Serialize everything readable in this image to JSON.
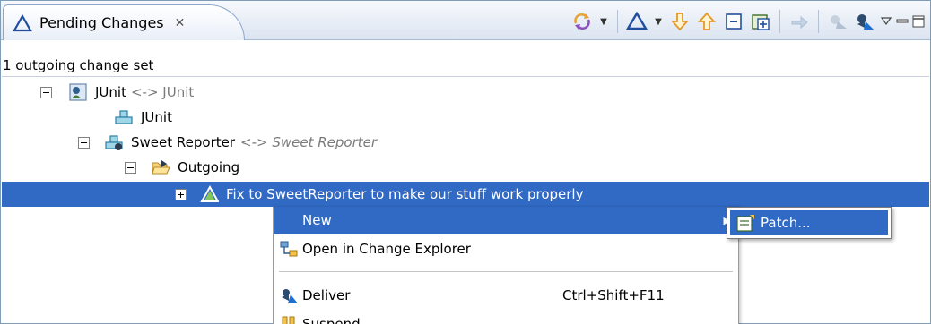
{
  "view": {
    "tab_label": "Pending Changes",
    "tab_close_glyph": "✕",
    "toolbar_icons": [
      "sync-icon",
      "warning-filter-icon",
      "expand-down-icon",
      "collapse-up-icon",
      "collapse-all-icon",
      "new-icon",
      "accept-icon",
      "deliver-icon",
      "deliver-all-icon",
      "view-menu-icon",
      "minimize-icon",
      "maximize-icon"
    ]
  },
  "status_line": "1 outgoing change set",
  "tree": {
    "root": {
      "name": "JUnit",
      "suffix": "<-> JUnit"
    },
    "component": {
      "name": "JUnit"
    },
    "component2": {
      "name": "Sweet Reporter",
      "suffix": "<-> Sweet Reporter"
    },
    "folder": {
      "name": "Outgoing"
    },
    "changeset": {
      "name": "Fix to SweetReporter to make our stuff work properly"
    }
  },
  "context_menu": {
    "new_label": "New",
    "open_explorer_label": "Open in Change Explorer",
    "deliver_label": "Deliver",
    "deliver_shortcut": "Ctrl+Shift+F11",
    "suspend_label": "Suspend"
  },
  "submenu": {
    "patch_label": "Patch..."
  },
  "colors": {
    "selection": "#316ac5",
    "accent": "#2060c0"
  }
}
